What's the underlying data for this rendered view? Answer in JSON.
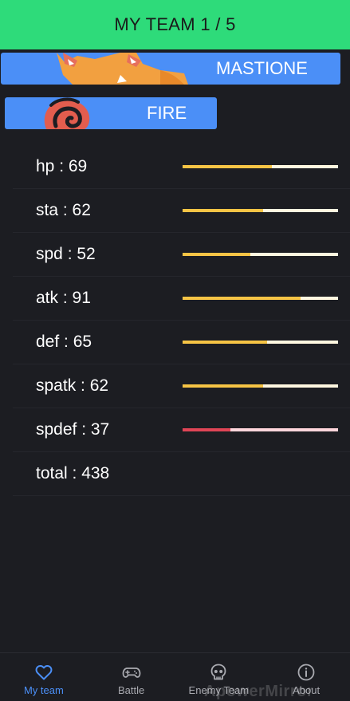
{
  "header": {
    "title": "MY TEAM 1 / 5",
    "color": "#2edb7a"
  },
  "pokemon": {
    "name": "MASTIONE",
    "type": "FIRE",
    "accent": "#4b8ff7"
  },
  "stats": [
    {
      "label": "hp : 69",
      "value": 69,
      "color": "#f6c445",
      "track": "#fff7e0"
    },
    {
      "label": "sta : 62",
      "value": 62,
      "color": "#f6c445",
      "track": "#fff7e0"
    },
    {
      "label": "spd : 52",
      "value": 52,
      "color": "#f6c445",
      "track": "#fff7e0"
    },
    {
      "label": "atk : 91",
      "value": 91,
      "color": "#f6c445",
      "track": "#fff7e0"
    },
    {
      "label": "def : 65",
      "value": 65,
      "color": "#f6c445",
      "track": "#fff7e0"
    },
    {
      "label": "spatk : 62",
      "value": 62,
      "color": "#f6c445",
      "track": "#fff7e0"
    },
    {
      "label": "spdef : 37",
      "value": 37,
      "color": "#e04556",
      "track": "#ffd6dc"
    }
  ],
  "stat_max": 120,
  "total": {
    "label": "total : 438"
  },
  "nav": {
    "items": [
      {
        "label": "My team",
        "icon": "heart-icon",
        "active": true
      },
      {
        "label": "Battle",
        "icon": "gamepad-icon",
        "active": false
      },
      {
        "label": "Enemy Team",
        "icon": "skull-icon",
        "active": false
      },
      {
        "label": "About",
        "icon": "info-icon",
        "active": false
      }
    ]
  },
  "watermark": "ApowerMirror"
}
